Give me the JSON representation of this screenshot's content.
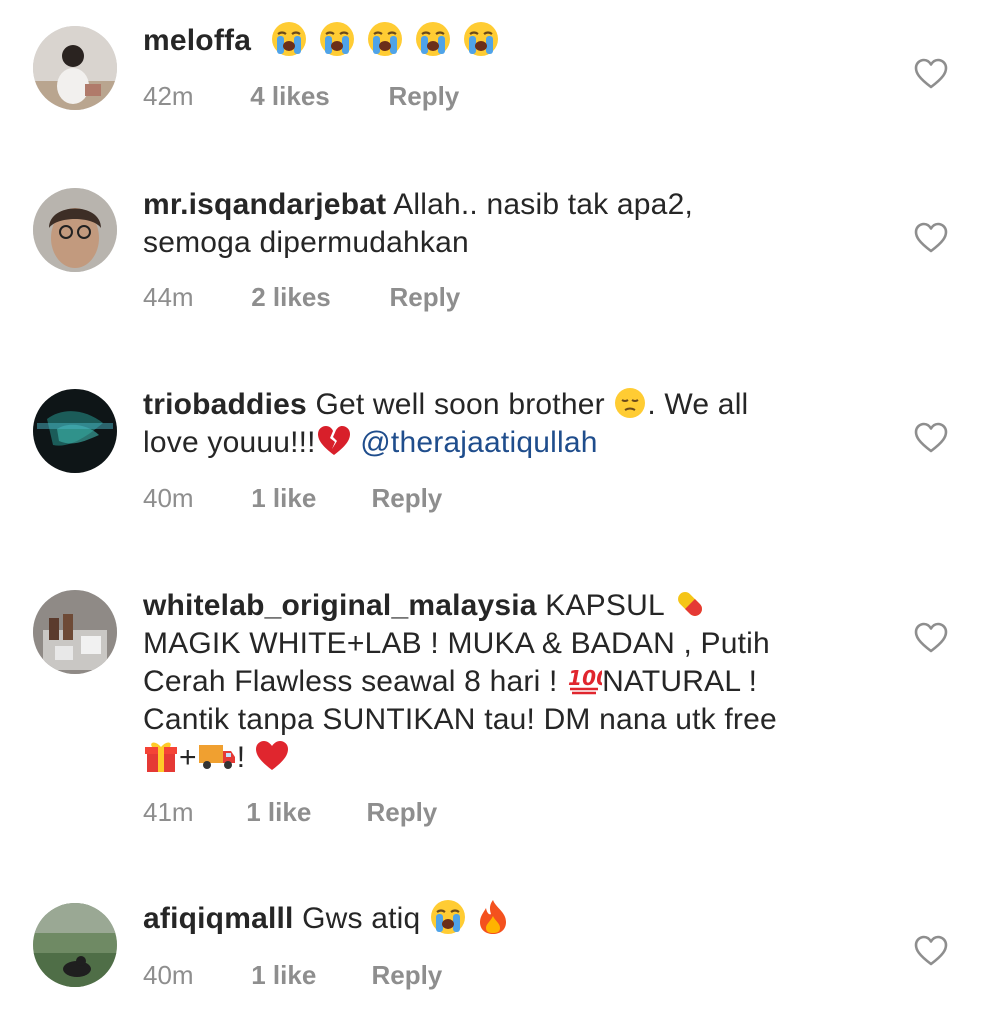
{
  "comments": [
    {
      "user": "meloffa",
      "text": "",
      "emoji_after": [
        "loudly-crying-face",
        "loudly-crying-face",
        "loudly-crying-face",
        "loudly-crying-face",
        "loudly-crying-face"
      ],
      "time": "42m",
      "likes": "4 likes",
      "reply": "Reply"
    },
    {
      "user": "mr.isqandarjebat",
      "line1": "Allah.. nasib tak apa2,",
      "line2": "semoga dipermudahkan",
      "time": "44m",
      "likes": "2 likes",
      "reply": "Reply"
    },
    {
      "user": "triobaddies",
      "line1a": "Get well soon brother",
      "line1b": ". We all",
      "line2a": "love youuu!!!",
      "mention": "@therajaatiqullah",
      "time": "40m",
      "likes": "1 like",
      "reply": "Reply"
    },
    {
      "user": "whitelab_original_malaysia",
      "line1": "KAPSUL",
      "line2": "MAGIK WHITE+LAB ! MUKA & BADAN , Putih",
      "line3a": "Cerah Flawless seawal 8 hari !",
      "line3b": "NATURAL !",
      "line4": "Cantik tanpa SUNTIKAN tau! DM nana utk free",
      "line5a": "+",
      "line5b": "!",
      "time": "41m",
      "likes": "1 like",
      "reply": "Reply"
    },
    {
      "user": "afiqiqmalll",
      "line1": "Gws atiq",
      "time": "40m",
      "likes": "1 like",
      "reply": "Reply"
    }
  ],
  "icons": {
    "like": "heart-outline-icon"
  },
  "colors": {
    "text": "#262626",
    "meta": "#8e8e8e",
    "mention": "#1f4d8c",
    "heart_stroke": "#8e8e8e"
  }
}
